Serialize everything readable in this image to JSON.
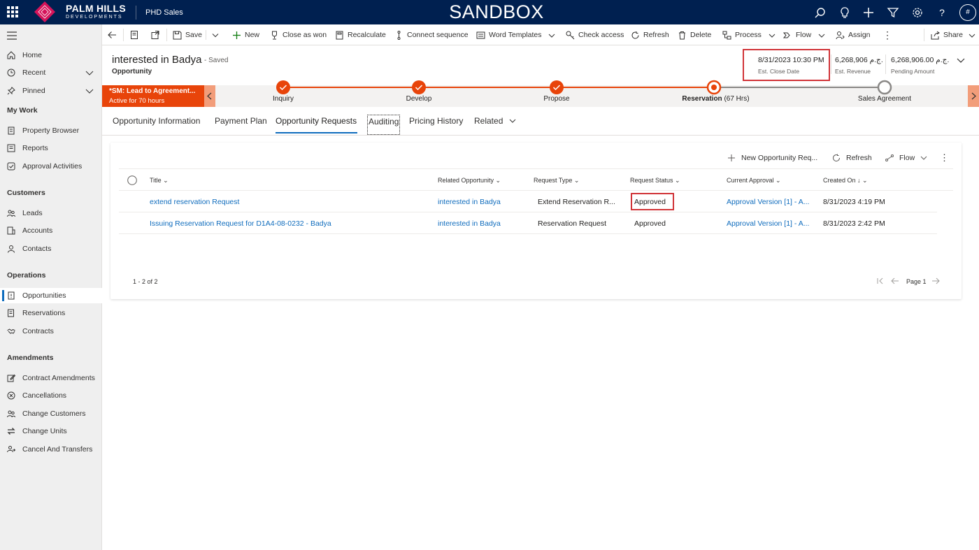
{
  "topbar": {
    "brand_line1": "PALM HILLS",
    "brand_line2": "DEVELOPMENTS",
    "app_name": "PHD Sales",
    "environment": "SANDBOX",
    "avatar_initial": "#",
    "bg_color": "#002050"
  },
  "sidebar": {
    "top_items": [
      {
        "label": "Home",
        "icon": "home-icon"
      },
      {
        "label": "Recent",
        "icon": "clock-icon"
      },
      {
        "label": "Pinned",
        "icon": "pin-icon"
      }
    ],
    "groups": [
      {
        "title": "My Work",
        "items": [
          {
            "label": "Property Browser",
            "icon": "building-icon"
          },
          {
            "label": "Reports",
            "icon": "report-icon"
          },
          {
            "label": "Approval Activities",
            "icon": "check-icon"
          }
        ]
      },
      {
        "title": "Customers",
        "items": [
          {
            "label": "Leads",
            "icon": "people-icon"
          },
          {
            "label": "Accounts",
            "icon": "building-icon"
          },
          {
            "label": "Contacts",
            "icon": "person-icon"
          }
        ]
      },
      {
        "title": "Operations",
        "items": [
          {
            "label": "Opportunities",
            "icon": "opportunity-icon"
          },
          {
            "label": "Reservations",
            "icon": "document-icon"
          },
          {
            "label": "Contracts",
            "icon": "handshake-icon"
          }
        ]
      },
      {
        "title": "Amendments",
        "items": [
          {
            "label": "Contract Amendments",
            "icon": "edit-icon"
          },
          {
            "label": "Cancellations",
            "icon": "cancel-icon"
          },
          {
            "label": "Change Customers",
            "icon": "people-icon"
          },
          {
            "label": "Change Units",
            "icon": "swap-icon"
          },
          {
            "label": "Cancel And Transfers",
            "icon": "transfer-icon"
          }
        ]
      }
    ],
    "active_item": "Opportunities"
  },
  "commands": {
    "save": "Save",
    "new": "New",
    "close_as_won": "Close as won",
    "recalculate": "Recalculate",
    "connect_sequence": "Connect sequence",
    "word_templates": "Word Templates",
    "check_access": "Check access",
    "refresh": "Refresh",
    "delete": "Delete",
    "process": "Process",
    "flow": "Flow",
    "assign": "Assign",
    "share": "Share"
  },
  "record": {
    "title": "interested in Badya",
    "saved_status": "- Saved",
    "entity": "Opportunity",
    "fields": [
      {
        "value": "8/31/2023 10:30 PM",
        "label": "Est. Close Date"
      },
      {
        "value": "6,268,906 ج.م.",
        "label": "Est. Revenue"
      },
      {
        "value": "6,268,906.00 ج.م.",
        "label": "Pending Amount"
      }
    ]
  },
  "bpf": {
    "process_name": "*SM: Lead to Agreement...",
    "active_for": "Active for 70 hours",
    "stages": [
      {
        "name": "Inquiry",
        "state": "done"
      },
      {
        "name": "Develop",
        "state": "done"
      },
      {
        "name": "Propose",
        "state": "done"
      },
      {
        "name": "Reservation",
        "state": "active",
        "duration": "(67 Hrs)"
      },
      {
        "name": "Sales Agreement",
        "state": "pending"
      }
    ],
    "accent": "#e8440a"
  },
  "tabs": [
    "Opportunity Information",
    "Payment Plan",
    "Opportunity Requests",
    "Auditing",
    "Pricing History",
    "Related"
  ],
  "active_tab": "Opportunity Requests",
  "grid": {
    "commands": {
      "new": "New Opportunity Req...",
      "refresh": "Refresh",
      "flow": "Flow"
    },
    "columns": [
      "Title",
      "Related Opportunity",
      "Request Type",
      "Request Status",
      "Current Approval",
      "Created On"
    ],
    "rows": [
      [
        "extend reservation Request",
        "interested in Badya",
        "Extend Reservation R...",
        "Approved",
        "Approval Version [1] - A...",
        "8/31/2023 4:19 PM"
      ],
      [
        "Issuing Reservation Request for D1A4-08-0232 - Badya",
        "interested in Badya",
        "Reservation Request",
        "Approved",
        "Approval Version [1] - A...",
        "8/31/2023 2:42 PM"
      ]
    ],
    "record_count": "1 - 2 of 2",
    "page_label": "Page 1"
  }
}
